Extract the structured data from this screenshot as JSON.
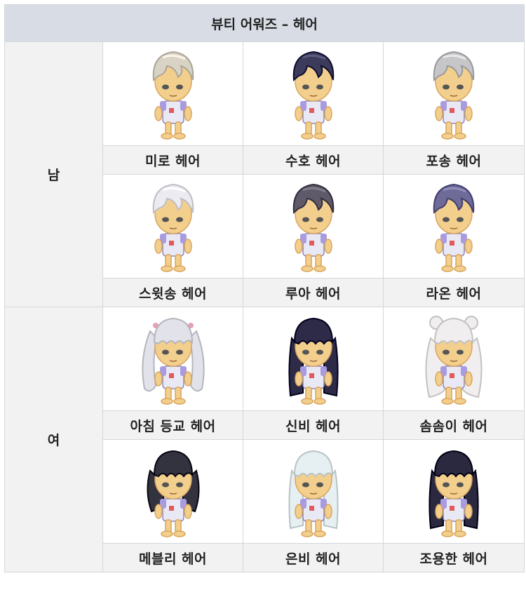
{
  "table": {
    "title": "뷰티 어워즈 – 헤어",
    "groups": [
      {
        "gender": "남",
        "rows": [
          [
            {
              "name": "미로 헤어",
              "hair_color": "#d9d3c6",
              "style": "short"
            },
            {
              "name": "수호 헤어",
              "hair_color": "#3c3b5c",
              "style": "short"
            },
            {
              "name": "포송 헤어",
              "hair_color": "#c6c6c9",
              "style": "short"
            }
          ],
          [
            {
              "name": "스윗송 헤어",
              "hair_color": "#ecebf2",
              "style": "short"
            },
            {
              "name": "루아 헤어",
              "hair_color": "#5f5a6a",
              "style": "short"
            },
            {
              "name": "라온 헤어",
              "hair_color": "#6f6b99",
              "style": "short"
            }
          ]
        ]
      },
      {
        "gender": "여",
        "rows": [
          [
            {
              "name": "아침 등교 헤어",
              "hair_color": "#e2e2ea",
              "style": "twintail"
            },
            {
              "name": "신비 헤어",
              "hair_color": "#2e2b48",
              "style": "long"
            },
            {
              "name": "솜솜이 헤어",
              "hair_color": "#f1eef0",
              "style": "bun"
            }
          ],
          [
            {
              "name": "메블리 헤어",
              "hair_color": "#33323f",
              "style": "medium"
            },
            {
              "name": "은비 헤어",
              "hair_color": "#e6f0f3",
              "style": "long"
            },
            {
              "name": "조용한 헤어",
              "hair_color": "#2a2940",
              "style": "long"
            }
          ]
        ]
      }
    ]
  }
}
